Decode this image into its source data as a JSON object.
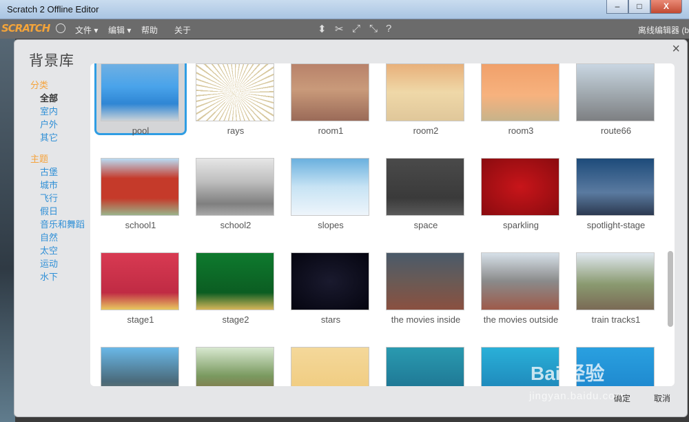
{
  "window": {
    "title": "Scratch 2 Offline Editor",
    "controls": [
      "–",
      "□",
      "X"
    ]
  },
  "menubar": {
    "logo": "SCRATCH",
    "menus": [
      "文件 ▾",
      "编辑 ▾",
      "帮助",
      "关于"
    ],
    "right_label": "离线编辑器 (b"
  },
  "dialog": {
    "title": "背景库",
    "close": "×",
    "ok_label": "确定",
    "cancel_label": "取消"
  },
  "categories": {
    "heading": "分类",
    "items": [
      "全部",
      "室内",
      "户外",
      "其它"
    ],
    "selected": "全部"
  },
  "themes": {
    "heading": "主题",
    "items": [
      "古堡",
      "城市",
      "飞行",
      "假日",
      "音乐和舞蹈",
      "自然",
      "太空",
      "运动",
      "水下"
    ]
  },
  "backdrops": [
    {
      "name": "pool",
      "selected": true
    },
    {
      "name": "rays"
    },
    {
      "name": "room1"
    },
    {
      "name": "room2"
    },
    {
      "name": "room3"
    },
    {
      "name": "route66"
    },
    {
      "name": "school1"
    },
    {
      "name": "school2"
    },
    {
      "name": "slopes"
    },
    {
      "name": "space"
    },
    {
      "name": "sparkling"
    },
    {
      "name": "spotlight-stage"
    },
    {
      "name": "stage1"
    },
    {
      "name": "stage2"
    },
    {
      "name": "stars"
    },
    {
      "name": "the movies inside"
    },
    {
      "name": "the movies outside"
    },
    {
      "name": "train tracks1"
    },
    {
      "name": ""
    },
    {
      "name": ""
    },
    {
      "name": ""
    },
    {
      "name": ""
    },
    {
      "name": ""
    },
    {
      "name": ""
    }
  ],
  "watermark": {
    "brand": "Bai 经验",
    "url": "jingyan.baidu.com"
  }
}
